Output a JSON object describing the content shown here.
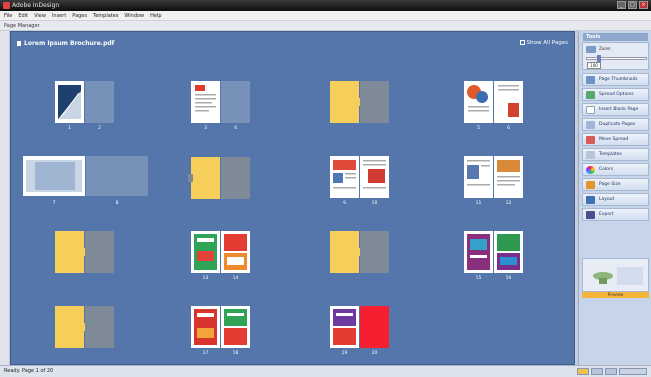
{
  "window": {
    "title": "Adobe InDesign"
  },
  "menu": [
    "File",
    "Edit",
    "View",
    "Insert",
    "Pages",
    "Templates",
    "Window",
    "Help"
  ],
  "toolbar": {
    "label": "Page Manager"
  },
  "pane": {
    "header": "Lorem Ipsum Brochure.pdf",
    "action": "Show All Pages"
  },
  "page_numbers": [
    "1",
    "2",
    "3",
    "4",
    "5",
    "6",
    "7",
    "8",
    "9",
    "10",
    "11",
    "12",
    "13",
    "14",
    "15",
    "16",
    "17",
    "18",
    "19",
    "20"
  ],
  "right_panel": {
    "title": "Tools",
    "zoom_label": "Zoom",
    "zoom_value": "100",
    "items": [
      "Page Thumbnails",
      "Spread Options",
      "Insert Blank Page",
      "Duplicate Pages",
      "Move Spread",
      "Templates",
      "Colors",
      "Page Size",
      "Layout",
      "Export"
    ],
    "preview_label": "Preview"
  },
  "status": {
    "text": "Ready. Page 1 of 20"
  },
  "colors": {
    "pane_bg": "#5476ab",
    "blank_page": "#7791b9",
    "gray_page": "#7e8a97",
    "yellow_page": "#f5cf5a",
    "red_page": "#f51f31"
  }
}
